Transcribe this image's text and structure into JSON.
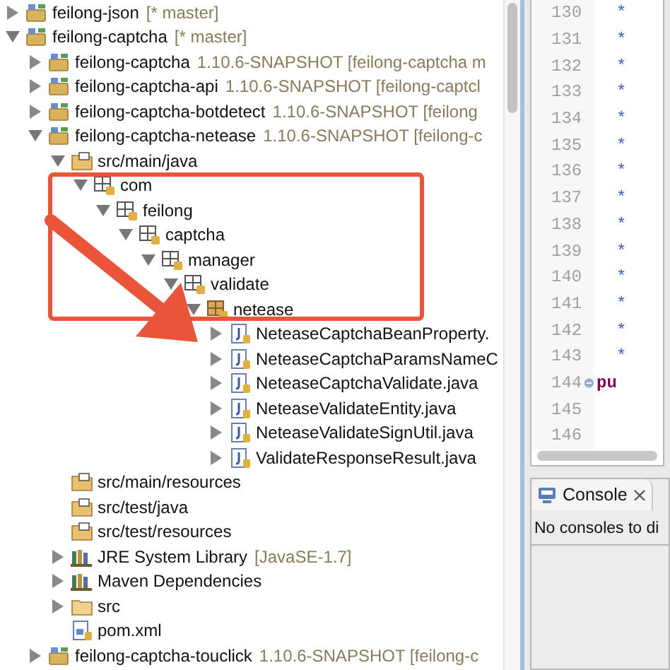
{
  "tree": [
    {
      "label": "feilong-json",
      "decoration": "[* master]",
      "kind": "project",
      "expanded": false
    },
    {
      "label": "feilong-captcha",
      "decoration": "[* master]",
      "kind": "project",
      "expanded": true,
      "children": [
        {
          "label": "feilong-captcha",
          "decoration": "1.10.6-SNAPSHOT [feilong-captcha m",
          "kind": "module",
          "expanded": false
        },
        {
          "label": "feilong-captcha-api",
          "decoration": "1.10.6-SNAPSHOT [feilong-captcl",
          "kind": "module",
          "expanded": false
        },
        {
          "label": "feilong-captcha-botdetect",
          "decoration": "1.10.6-SNAPSHOT [feilong",
          "kind": "module",
          "expanded": false
        },
        {
          "label": "feilong-captcha-netease",
          "decoration": "1.10.6-SNAPSHOT [feilong-c",
          "kind": "module",
          "expanded": true,
          "children": [
            {
              "label": "src/main/java",
              "kind": "source_folder",
              "expanded": true,
              "children": [
                {
                  "label": "com",
                  "kind": "package",
                  "expanded": true,
                  "children": [
                    {
                      "label": "feilong",
                      "kind": "package",
                      "expanded": true,
                      "children": [
                        {
                          "label": "captcha",
                          "kind": "package",
                          "expanded": true,
                          "children": [
                            {
                              "label": "manager",
                              "kind": "package",
                              "expanded": true,
                              "children": [
                                {
                                  "label": "validate",
                                  "kind": "package",
                                  "expanded": true,
                                  "children": [
                                    {
                                      "label": "netease",
                                      "kind": "package_full",
                                      "expanded": true,
                                      "children": [
                                        {
                                          "label": "NeteaseCaptchaBeanProperty.",
                                          "kind": "java_file",
                                          "expanded": false
                                        },
                                        {
                                          "label": "NeteaseCaptchaParamsNameC",
                                          "kind": "java_file",
                                          "expanded": false
                                        },
                                        {
                                          "label": "NeteaseCaptchaValidate.java",
                                          "kind": "java_file",
                                          "expanded": false
                                        },
                                        {
                                          "label": "NeteaseValidateEntity.java",
                                          "kind": "java_file",
                                          "expanded": false
                                        },
                                        {
                                          "label": "NeteaseValidateSignUtil.java",
                                          "kind": "java_file",
                                          "expanded": false
                                        },
                                        {
                                          "label": "ValidateResponseResult.java",
                                          "kind": "java_file",
                                          "expanded": false
                                        }
                                      ]
                                    }
                                  ]
                                }
                              ]
                            }
                          ]
                        }
                      ]
                    }
                  ]
                }
              ]
            },
            {
              "label": "src/main/resources",
              "kind": "source_folder"
            },
            {
              "label": "src/test/java",
              "kind": "source_folder"
            },
            {
              "label": "src/test/resources",
              "kind": "source_folder"
            },
            {
              "label": "JRE System Library",
              "decoration": "[JavaSE-1.7]",
              "kind": "library",
              "expanded": false
            },
            {
              "label": "Maven Dependencies",
              "kind": "library",
              "expanded": false
            },
            {
              "label": "src",
              "kind": "folder",
              "expanded": false
            },
            {
              "label": "pom.xml",
              "kind": "xml_file"
            }
          ]
        },
        {
          "label": "feilong-captcha-touclick",
          "decoration": "1.10.6-SNAPSHOT [feilong-c",
          "kind": "module",
          "expanded": false
        }
      ]
    }
  ],
  "editor": {
    "lines": [
      {
        "number": "130",
        "code": "*"
      },
      {
        "number": "131",
        "code": "*"
      },
      {
        "number": "132",
        "code": "*"
      },
      {
        "number": "133",
        "code": "*"
      },
      {
        "number": "134",
        "code": "*"
      },
      {
        "number": "135",
        "code": "*"
      },
      {
        "number": "136",
        "code": "*"
      },
      {
        "number": "137",
        "code": "*"
      },
      {
        "number": "138",
        "code": "*"
      },
      {
        "number": "139",
        "code": "*"
      },
      {
        "number": "140",
        "code": "*"
      },
      {
        "number": "141",
        "code": "*"
      },
      {
        "number": "142",
        "code": "*"
      },
      {
        "number": "143",
        "code": "*"
      },
      {
        "number": "144",
        "code": "pu",
        "kind": "keyword",
        "foldable": true
      },
      {
        "number": "145"
      },
      {
        "number": "146"
      }
    ]
  },
  "console": {
    "tab": "Console",
    "message": "No consoles to di"
  }
}
